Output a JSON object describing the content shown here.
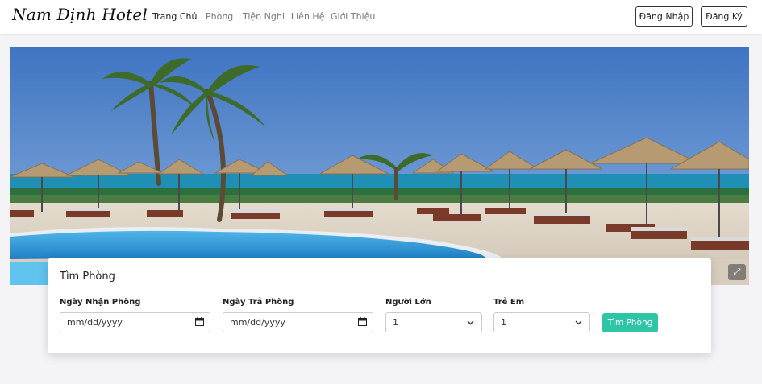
{
  "brand": "Nam Định Hotel",
  "nav": {
    "links": [
      "Trang Chủ",
      "Phòng",
      "Tiện Nghi",
      "Liên Hệ",
      "Giới Thiệu"
    ],
    "active_index": 0,
    "login_label": "Đăng Nhập",
    "register_label": "Đăng Ký"
  },
  "hero": {
    "image": "beach-resort-pool-photo",
    "expand_icon": "expand-icon"
  },
  "search": {
    "title": "Tìm Phòng",
    "checkin_label": "Ngày Nhận Phòng",
    "checkin_value": "mm/dd/yyyy",
    "checkout_label": "Ngày Trả Phòng",
    "checkout_value": "mm/dd/yyyy",
    "adults_label": "Người Lớn",
    "adults_value": "1",
    "children_label": "Trẻ Em",
    "children_value": "1",
    "button_label": "Tìm Phòng"
  },
  "colors": {
    "accent": "#2ec4a6",
    "page_bg": "#f4f4f6"
  }
}
